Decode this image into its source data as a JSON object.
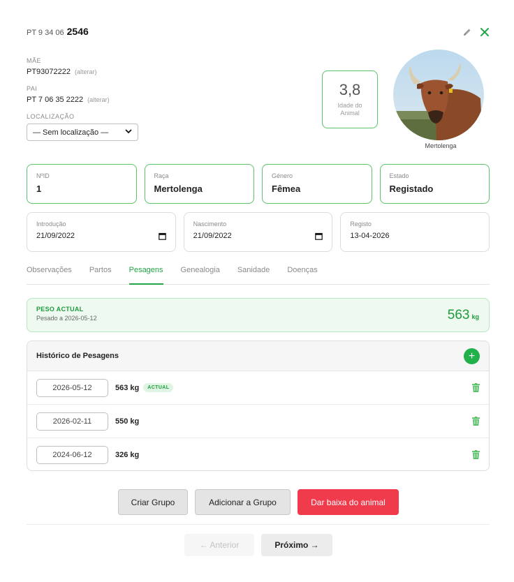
{
  "header": {
    "tag_prefix": "PT 9 34 06",
    "tag_number": "2546"
  },
  "parents": {
    "mother_label": "MÃE",
    "mother_value": "PT93072222",
    "father_label": "PAI",
    "father_value": "PT 7 06 35 2222",
    "alter_label": "(alterar)",
    "location_label": "LOCALIZAÇÃO",
    "location_value": "— Sem localização —"
  },
  "age": {
    "value": "3,8",
    "label_line1": "Idade do",
    "label_line2": "Animal"
  },
  "photo": {
    "caption": "Mertolenga"
  },
  "fields": {
    "id_label": "NºID",
    "id_value": "1",
    "breed_label": "Raça",
    "breed_value": "Mertolenga",
    "gender_label": "Género",
    "gender_value": "Fêmea",
    "state_label": "Estado",
    "state_value": "Registado",
    "intro_label": "Introdução",
    "intro_value": "21/09/2022",
    "birth_label": "Nascimento",
    "birth_value": "21/09/2022",
    "register_label": "Registo",
    "register_value": "13-04-2026"
  },
  "tabs": [
    {
      "label": "Observações",
      "active": false
    },
    {
      "label": "Partos",
      "active": false
    },
    {
      "label": "Pesagens",
      "active": true
    },
    {
      "label": "Genealogia",
      "active": false
    },
    {
      "label": "Sanidade",
      "active": false
    },
    {
      "label": "Doenças",
      "active": false
    }
  ],
  "current_weight": {
    "title": "PESO ACTUAL",
    "subtitle": "Pesado a 2026-05-12",
    "value": "563",
    "unit": "kg"
  },
  "history": {
    "title": "Histórico de Pesagens",
    "add_label": "+",
    "badge_label": "ACTUAL",
    "rows": [
      {
        "date": "2026-05-12",
        "weight": "563 kg",
        "current": true
      },
      {
        "date": "2026-02-11",
        "weight": "550 kg",
        "current": false
      },
      {
        "date": "2024-06-12",
        "weight": "326 kg",
        "current": false
      }
    ]
  },
  "actions": {
    "create_group": "Criar Grupo",
    "add_to_group": "Adicionar a Grupo",
    "remove_animal": "Dar baixa do animal"
  },
  "nav": {
    "prev": "← Anterior",
    "next": "Próximo →"
  },
  "colors": {
    "accent_green": "#22a447",
    "danger_red": "#ef3b4c"
  },
  "icons": {
    "edit": "pencil-icon",
    "close": "close-icon",
    "calendar": "calendar-icon",
    "delete": "trash-icon",
    "add": "plus-icon"
  }
}
